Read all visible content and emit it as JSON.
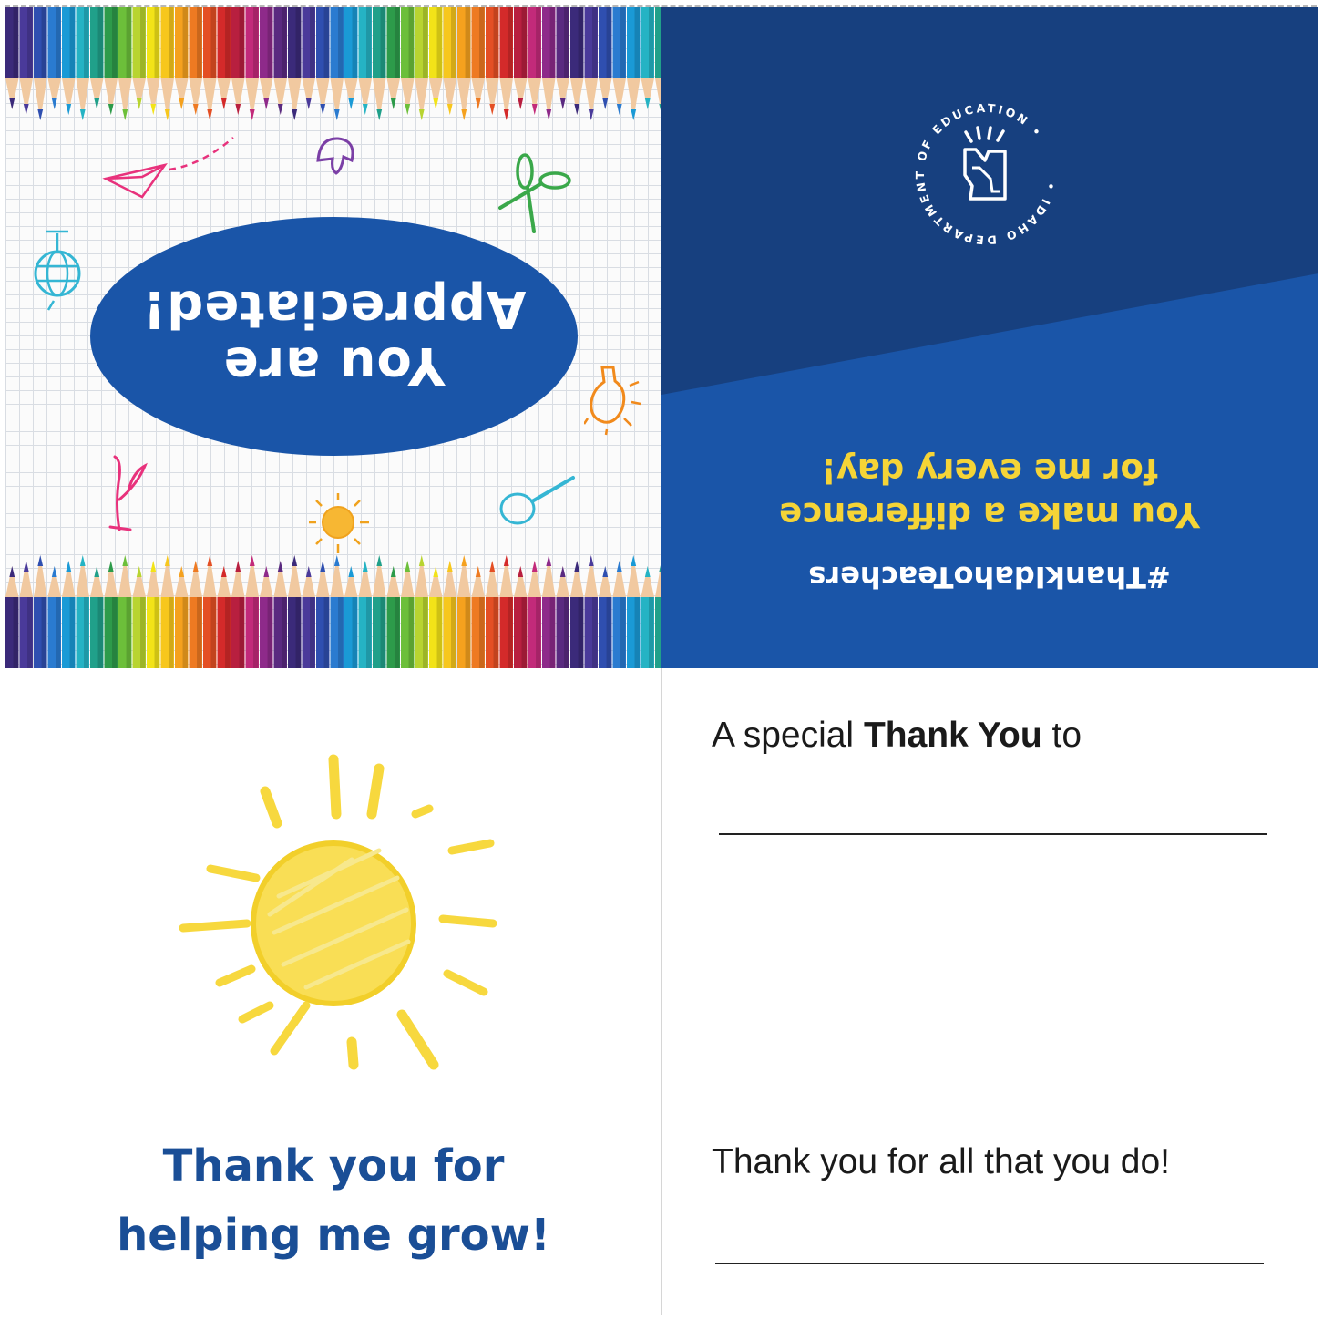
{
  "front": {
    "ellipse_line1": "You are",
    "ellipse_line2": "Appreciated!"
  },
  "back": {
    "seal_text": "IDAHO DEPARTMENT OF EDUCATION",
    "message_line1": "You make a difference",
    "message_line2": "for me every day!",
    "hashtag": "#ThankIdahoTeachers"
  },
  "inside_left": {
    "line1": "Thank you for",
    "line2": "helping me grow!"
  },
  "inside_right": {
    "prefix": "A special ",
    "bold": "Thank You",
    "suffix": " to",
    "closing": "Thank you for all that you do!"
  },
  "colors": {
    "brand_blue": "#1a55a8",
    "dark_blue": "#17407f",
    "accent_yellow": "#f5d437",
    "heading_blue": "#1a4e96"
  }
}
